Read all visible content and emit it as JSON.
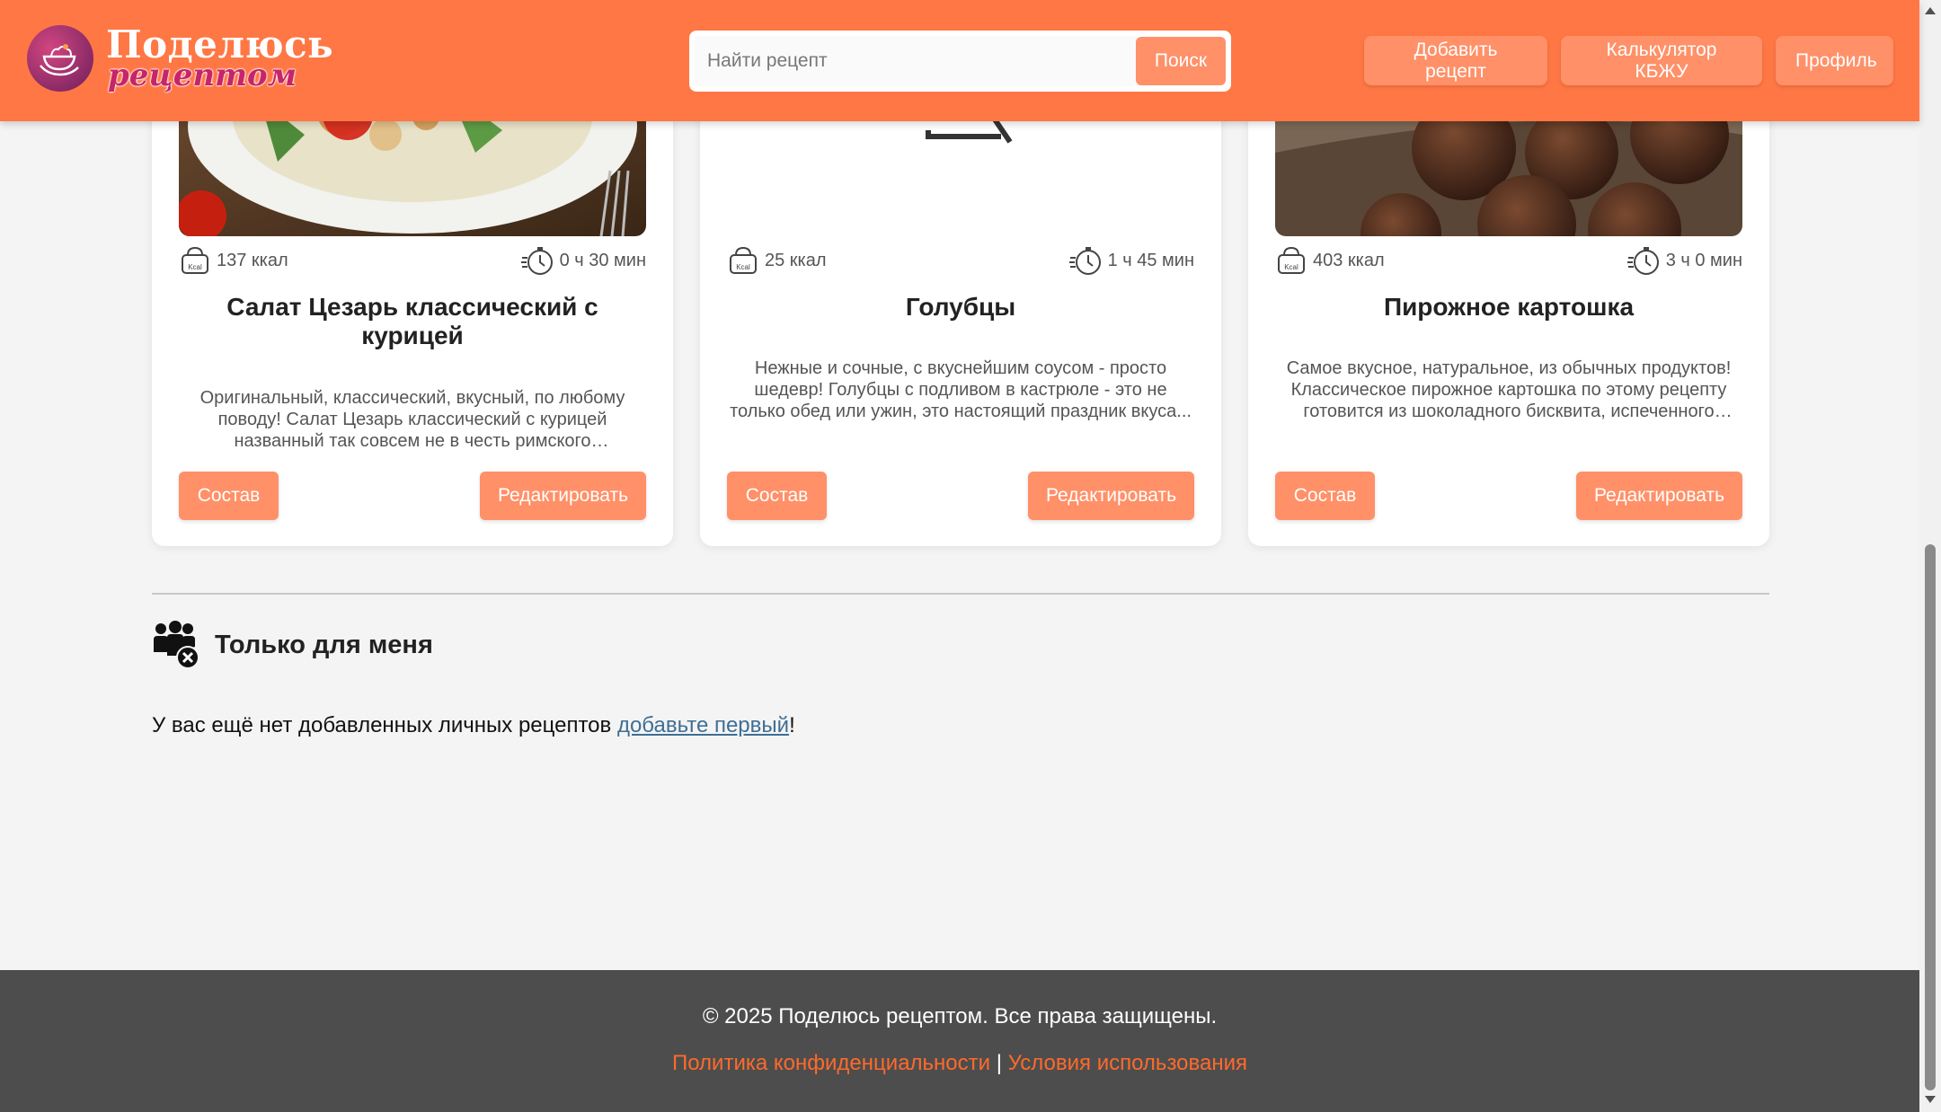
{
  "header": {
    "logo_line1": "Поделюсь",
    "logo_line2": "рецептом",
    "search_placeholder": "Найти рецепт",
    "search_button": "Поиск",
    "nav": {
      "add_recipe": "Добавить рецепт",
      "calculator": "Калькулятор КБЖУ",
      "profile": "Профиль"
    }
  },
  "recipes": [
    {
      "kcal": "137 ккал",
      "time": "0 ч 30 мин",
      "title": "Салат Цезарь классический с курицей",
      "description": "Оригинальный, классический, вкусный, по любому поводу! Салат Цезарь классический с курицей названный так совсем не в честь римского императора...",
      "btn_composition": "Состав",
      "btn_edit": "Редактировать"
    },
    {
      "kcal": "25 ккал",
      "time": "1 ч 45 мин",
      "title": "Голубцы",
      "description": "Нежные и сочные, с вкуснейшим соусом - просто шедевр! Голубцы с подливом в кастрюле - это не только обед или ужин, это настоящий праздник вкуса...",
      "btn_composition": "Состав",
      "btn_edit": "Редактировать"
    },
    {
      "kcal": "403 ккал",
      "time": "3 ч 0 мин",
      "title": "Пирожное картошка",
      "description": "Самое вкусное, натуральное, из обычных продуктов! Классическое пирожное картошка по этому рецепту готовится из шоколадного бисквита, испеченного заранее...",
      "btn_composition": "Состав",
      "btn_edit": "Редактировать"
    }
  ],
  "personal": {
    "title": "Только для меня",
    "empty_text": "У вас ещё нет добавленных личных рецептов ",
    "empty_link": "добавьте первый",
    "empty_end": "!"
  },
  "footer": {
    "copyright": "© 2025 Поделюсь рецептом. Все права защищены.",
    "privacy": "Политика конфиденциальности",
    "separator": " | ",
    "terms": "Условия использования"
  },
  "colors": {
    "header": "#ff7744",
    "button": "#ff9068",
    "footer": "#4d4d4d",
    "footer_link": "#ff6a2a",
    "link": "#3f6f95"
  },
  "icons": {
    "kcal": "kcal-scale-icon",
    "time": "stopwatch-icon",
    "personal": "people-private-icon",
    "logo": "bowl-hand-logo-icon"
  }
}
